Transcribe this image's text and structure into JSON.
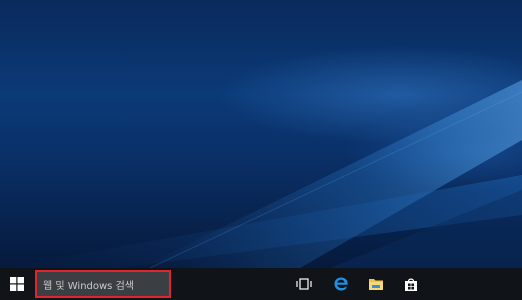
{
  "taskbar": {
    "search_placeholder": "웹 및 Windows 검색",
    "icons": [
      "windows-logo-icon",
      "task-view-icon",
      "edge-icon",
      "file-explorer-icon",
      "store-icon"
    ]
  },
  "colors": {
    "desktop_blue": "#0b3a78",
    "taskbar_bg": "#101418",
    "search_bg": "#3b3f43",
    "highlight_red": "#e0262c",
    "edge_blue": "#1e90e6",
    "folder_yellow": "#f2c34c"
  }
}
